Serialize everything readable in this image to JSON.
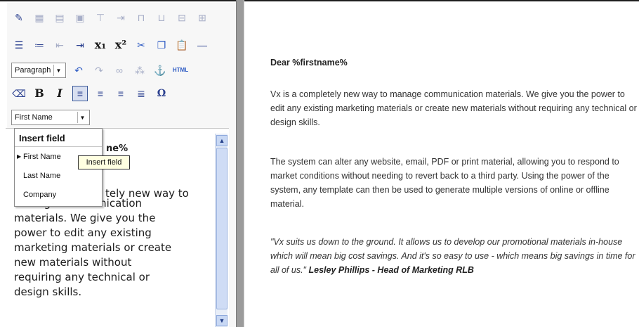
{
  "toolbar": {
    "format_select": "Paragraph",
    "html_label": "HTML",
    "field_select": "First Name"
  },
  "insert_menu": {
    "header": "Insert field",
    "items": [
      "First Name",
      "Last Name",
      "Company"
    ],
    "tooltip": "Insert field"
  },
  "editor": {
    "peek_placeholder": "ne%",
    "peek_text": "tely new way to",
    "lines": [
      "manage communication",
      "materials. We give you the",
      "power to edit any existing",
      "marketing materials or create",
      "new materials without",
      "requiring any technical or",
      "design skills."
    ]
  },
  "preview": {
    "greeting": "Dear %firstname%",
    "paragraph1": "Vx is a completely new way to manage communication materials. We give you the power to edit any existing marketing materials or create new materials without requiring any technical or design skills.",
    "paragraph2": "The system can alter any website, email, PDF or print material, allowing you to respond to market conditions without needing to revert back to a third party. Using the power of the system, any template can then be used to generate multiple versions of online or offline material.",
    "quote": "\"Vx suits us down to the ground. It allows us to develop our promotional materials in-house which will mean big cost savings. And it's so easy to use - which means big savings in time for all of us.\"",
    "quote_author": "Lesley Phillips - Head of Marketing RLB"
  }
}
